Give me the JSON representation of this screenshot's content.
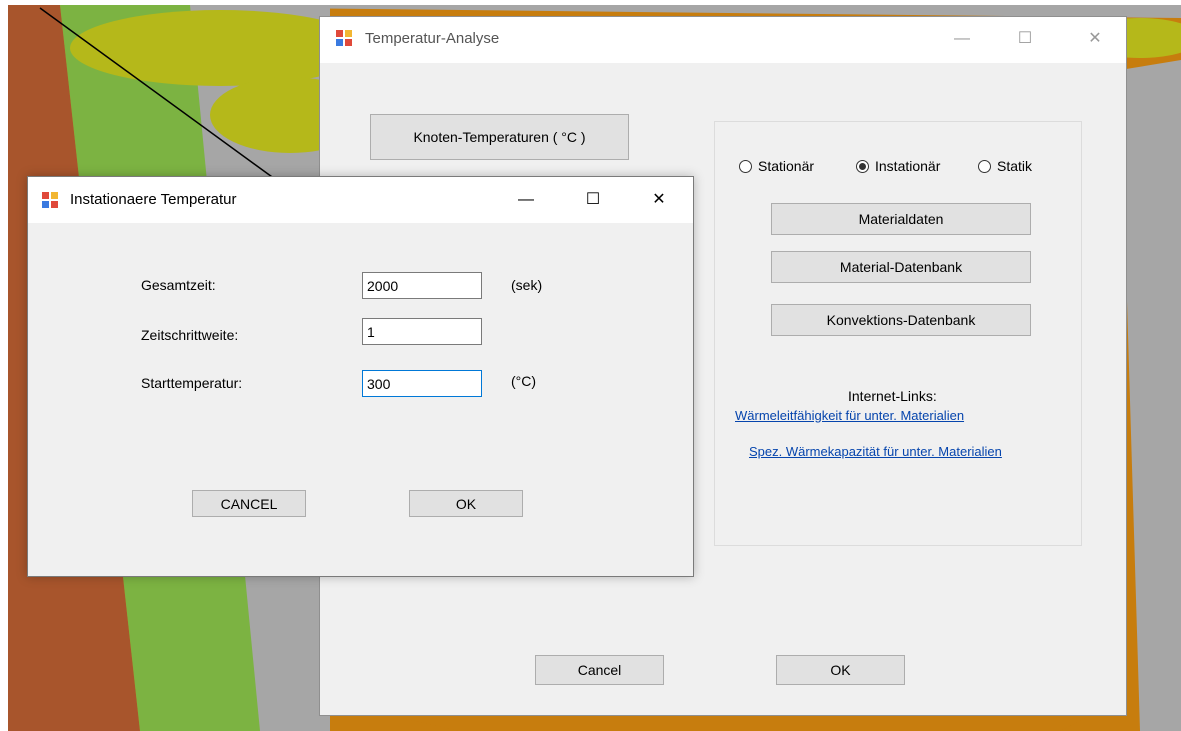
{
  "main_window": {
    "title": "Temperatur-Analyse",
    "minimize_glyph": "—",
    "maximize_glyph": "☐",
    "close_glyph": "✕",
    "knoten_button": "Knoten-Temperaturen ( °C )",
    "radios": [
      {
        "label": "Stationär",
        "checked": false
      },
      {
        "label": "Instationär",
        "checked": true
      },
      {
        "label": "Statik",
        "checked": false
      }
    ],
    "materialdaten_button": "Materialdaten",
    "material_datenbank_button": "Material-Datenbank",
    "konvektions_button": "Konvektions-Datenbank",
    "links_heading": "Internet-Links:",
    "link1": "Wärmeleitfähigkeit für unter. Materialien",
    "link2": "Spez. Wärmekapazität für unter. Materialien",
    "cancel_button": "Cancel",
    "ok_button": "OK"
  },
  "dialog": {
    "title": "Instationaere Temperatur",
    "minimize_glyph": "—",
    "maximize_glyph": "☐",
    "close_glyph": "✕",
    "fields": [
      {
        "label": "Gesamtzeit:",
        "value": "2000",
        "unit": "(sek)"
      },
      {
        "label": "Zeitschrittweite:",
        "value": "1",
        "unit": ""
      },
      {
        "label": "Starttemperatur:",
        "value": "300",
        "unit": "(°C)"
      }
    ],
    "cancel_button": "CANCEL",
    "ok_button": "OK"
  },
  "colors": {
    "window_bg": "#f0f0f0",
    "titlebar_bg": "#ffffff",
    "button_bg": "#e1e1e1",
    "link": "#0645ad",
    "focus_border": "#0078d7",
    "bg_green": "#7cb342",
    "bg_olive": "#b5b81a",
    "bg_orange": "#c77d0e",
    "bg_rust": "#a8552c",
    "bg_gray": "#a6a6a6"
  }
}
